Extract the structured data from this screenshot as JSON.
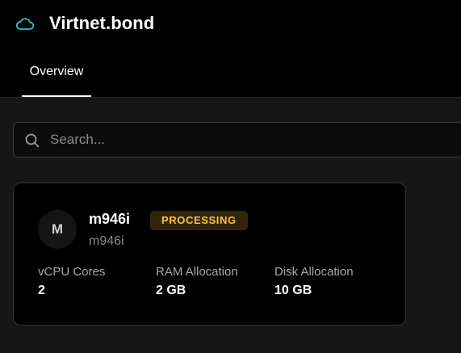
{
  "header": {
    "title": "Virtnet.bond",
    "brand_icon": "cloud-icon",
    "brand_color": "#2ec4d6"
  },
  "tabs": [
    {
      "label": "Overview",
      "active": true
    }
  ],
  "search": {
    "placeholder": "Search...",
    "value": "",
    "icon": "search-icon"
  },
  "server": {
    "avatar_letter": "M",
    "name": "m946i",
    "subtitle": "m946i",
    "status": "PROCESSING",
    "status_color": "#f3c544",
    "stats": [
      {
        "label": "vCPU Cores",
        "value": "2"
      },
      {
        "label": "RAM Allocation",
        "value": "2 GB"
      },
      {
        "label": "Disk Allocation",
        "value": "10 GB"
      }
    ]
  }
}
